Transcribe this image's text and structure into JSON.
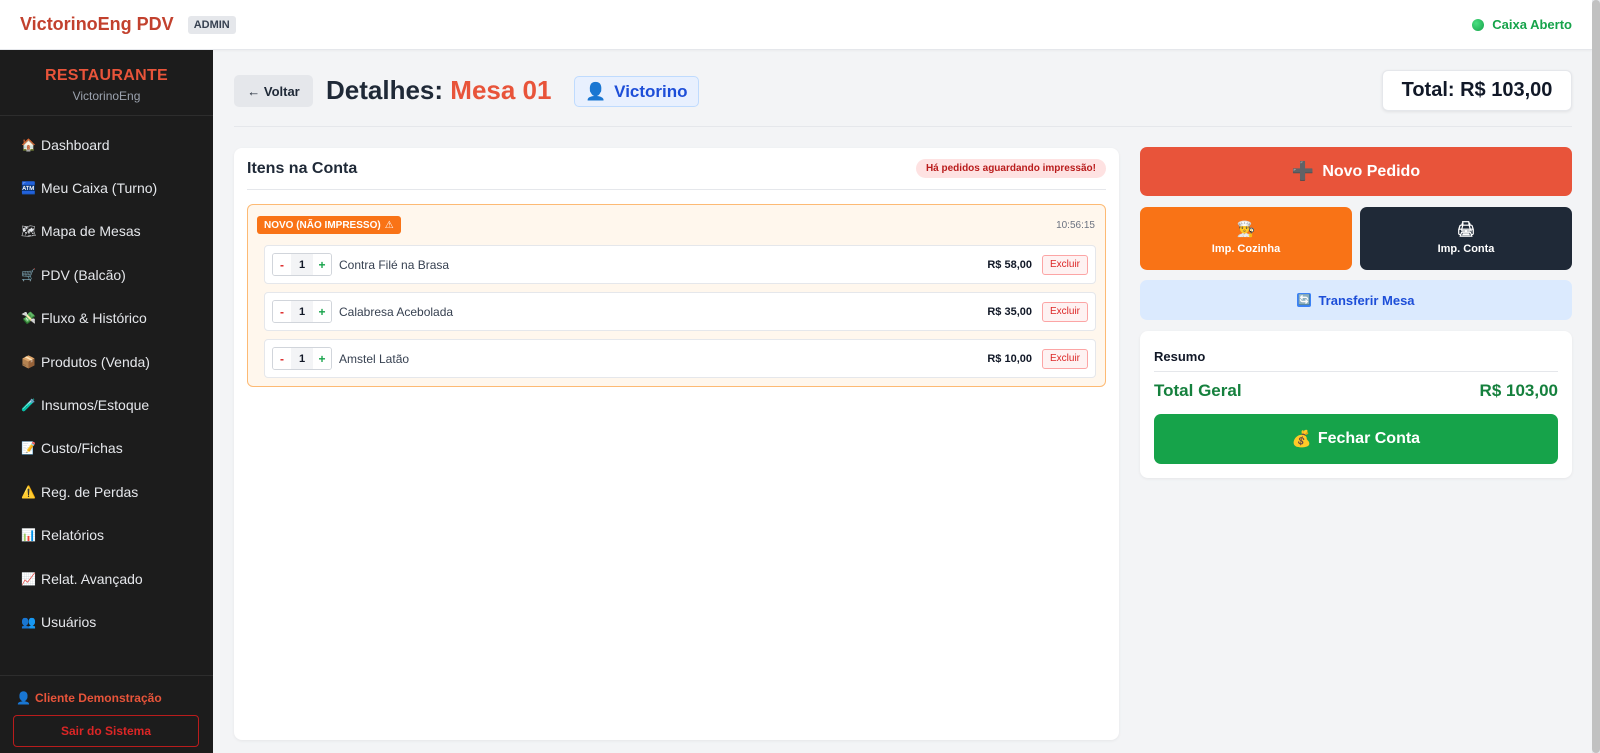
{
  "app": {
    "brand": "VictorinoEng PDV",
    "role_badge": "ADMIN",
    "caixa_status": "Caixa Aberto",
    "status_color": "#16a34a"
  },
  "sidebar": {
    "title": "RESTAURANTE",
    "subtitle": "VictorinoEng",
    "items": [
      {
        "icon": "🏠",
        "icon_name": "house-icon",
        "label": "Dashboard"
      },
      {
        "icon": "🏧",
        "icon_name": "atm-icon",
        "label": "Meu Caixa (Turno)"
      },
      {
        "icon": "🗺",
        "icon_name": "map-icon",
        "label": "Mapa de Mesas"
      },
      {
        "icon": "🛒",
        "icon_name": "cart-icon",
        "label": "PDV (Balcão)"
      },
      {
        "icon": "💸",
        "icon_name": "money-wings-icon",
        "label": "Fluxo & Histórico"
      },
      {
        "icon": "📦",
        "icon_name": "package-icon",
        "label": "Produtos (Venda)"
      },
      {
        "icon": "🧪",
        "icon_name": "test-tube-icon",
        "label": "Insumos/Estoque"
      },
      {
        "icon": "📝",
        "icon_name": "memo-icon",
        "label": "Custo/Fichas"
      },
      {
        "icon": "⚠️",
        "icon_name": "warning-icon",
        "label": "Reg. de Perdas"
      },
      {
        "icon": "📊",
        "icon_name": "bar-chart-icon",
        "label": "Relatórios"
      },
      {
        "icon": "📈",
        "icon_name": "trend-chart-icon",
        "label": "Relat. Avançado"
      },
      {
        "icon": "👥",
        "icon_name": "users-icon",
        "label": "Usuários"
      }
    ],
    "client_icon": "👤",
    "client_name": "Cliente Demonstração",
    "logout_label": "Sair do Sistema"
  },
  "header": {
    "back_label": "← Voltar",
    "title_prefix": "Detalhes:",
    "mesa_name": "Mesa 01",
    "waiter_icon": "👤",
    "waiter_name": "Victorino",
    "total_label": "Total: R$ 103,00"
  },
  "items_section": {
    "title": "Itens na Conta",
    "pending_badge": "Há pedidos aguardando impressão!",
    "group": {
      "status_label": "NOVO (NÃO IMPRESSO)",
      "warning_icon": "⚠",
      "time": "10:56:15"
    },
    "items": [
      {
        "qty": "1",
        "name": "Contra Filé na Brasa",
        "price": "R$ 58,00"
      },
      {
        "qty": "1",
        "name": "Calabresa Acebolada",
        "price": "R$ 35,00"
      },
      {
        "qty": "1",
        "name": "Amstel Latão",
        "price": "R$ 10,00"
      }
    ],
    "minus_label": "-",
    "plus_label": "+",
    "delete_label": "Excluir"
  },
  "actions": {
    "novo_icon": "➕",
    "novo_label": "Novo Pedido",
    "imp_cozinha_icon": "👨‍🍳",
    "imp_cozinha_label": "Imp. Cozinha",
    "imp_conta_icon": "🖨",
    "imp_conta_label": "Imp. Conta",
    "transfer_icon": "🔄",
    "transfer_label": "Transferir Mesa",
    "resumo_title": "Resumo",
    "total_geral_label": "Total Geral",
    "total_geral_value": "R$ 103,00",
    "fechar_icon": "💰",
    "fechar_label": "Fechar Conta"
  },
  "colors": {
    "accent_red": "#e8543a",
    "orange": "#f97316",
    "dark": "#1f2937",
    "green": "#16a34a",
    "blue_light": "#dbeafe"
  }
}
